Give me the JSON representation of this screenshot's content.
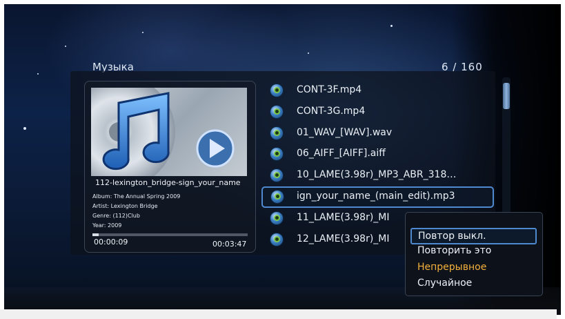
{
  "header": {
    "title": "Музыка",
    "count": "6 / 160"
  },
  "now_playing": {
    "title": "112-lexington_bridge-sign_your_name",
    "album": "Album: The Annual Spring 2009",
    "artist": "Artist: Lexington Bridge",
    "genre": "Genre: (112)Club",
    "year": "Year: 2009",
    "elapsed": "00:00:09",
    "total": "00:03:47",
    "progress_fraction": 0.04
  },
  "files": [
    {
      "name": "CONT-3F.mp4",
      "selected": false
    },
    {
      "name": "CONT-3G.mp4",
      "selected": false
    },
    {
      "name": "01_WAV_[WAV].wav",
      "selected": false
    },
    {
      "name": "06_AIFF_[AIFF].aiff",
      "selected": false
    },
    {
      "name": "10_LAME(3.98r)_MP3_ABR_318…",
      "selected": false
    },
    {
      "name": "ign_your_name_(main_edit).mp3",
      "selected": true
    },
    {
      "name": "11_LAME(3.98r)_MI",
      "selected": false
    },
    {
      "name": "12_LAME(3.98r)_MI",
      "selected": false
    }
  ],
  "repeat_menu": {
    "items": [
      {
        "label": "Повтор выкл.",
        "state": "focused"
      },
      {
        "label": "Повторить это",
        "state": "normal"
      },
      {
        "label": "Непрерывное",
        "state": "active"
      },
      {
        "label": "Случайное",
        "state": "normal"
      }
    ]
  },
  "colors": {
    "accent_border": "#4f8ad0",
    "active_option": "#f4b13b"
  },
  "icons": {
    "file": "music-file-icon",
    "play": "play-icon",
    "album_art": "itunes-note-icon"
  }
}
